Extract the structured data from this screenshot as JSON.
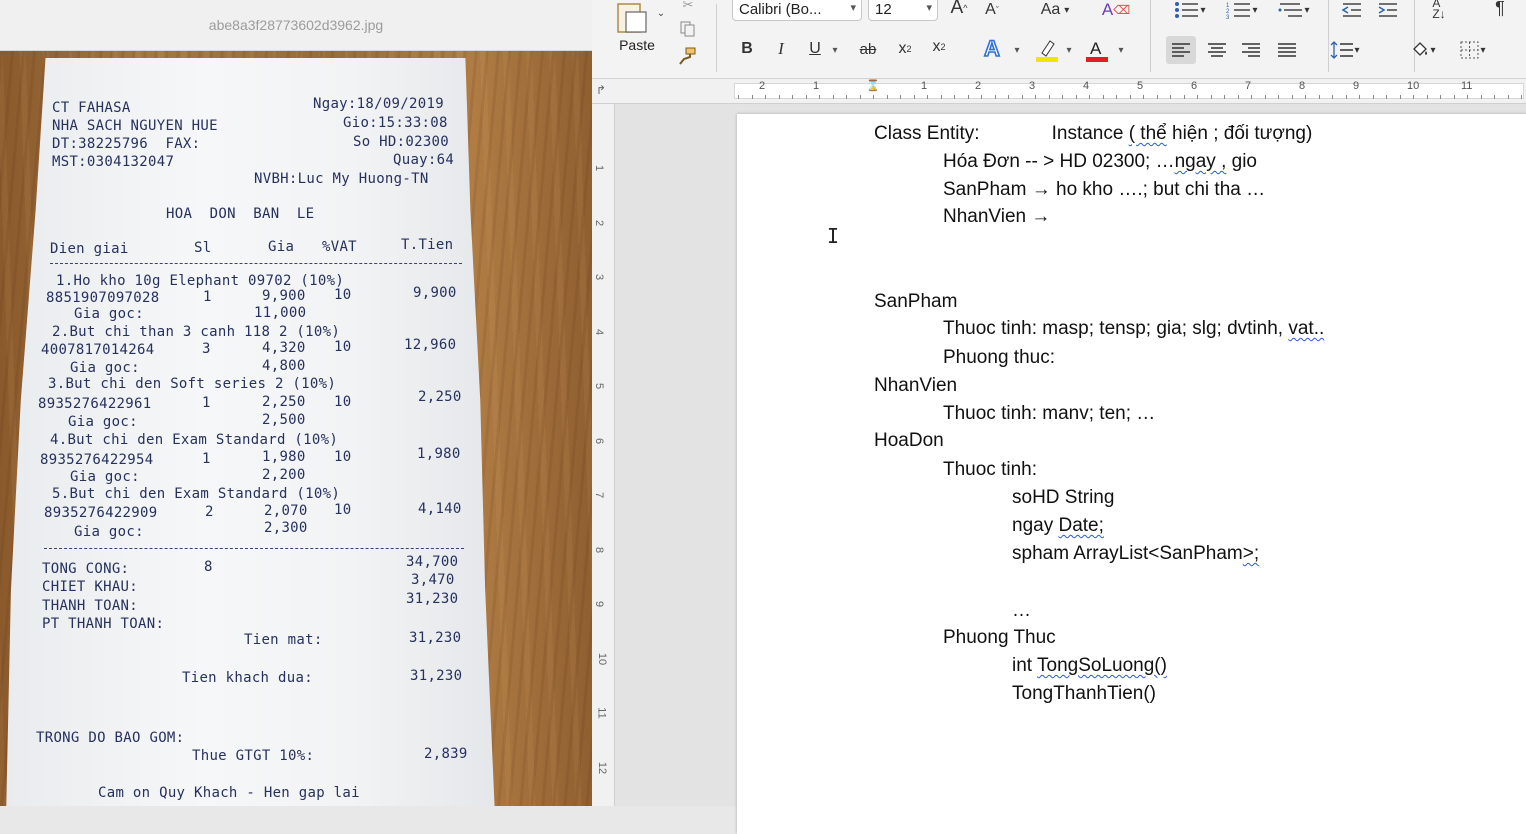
{
  "viewer": {
    "title": "abe8a3f28773602d3962.jpg",
    "receipt": {
      "store": "CT FAHASA",
      "branch": "NHA SACH NGUYEN HUE",
      "phone_fax": "DT:38225796  FAX:",
      "tax_id": "MST:0304132047",
      "date": "Ngay:18/09/2019",
      "time": "Gio:15:33:08",
      "invoice_no": "So HD:02300",
      "counter": "Quay:64",
      "staff": "NVBH:Luc My Huong-TN",
      "heading": "HOA  DON  BAN  LE",
      "col_desc": "Dien giai",
      "col_qty": "Sl",
      "col_price": "Gia",
      "col_vat": "%VAT",
      "col_total": "T.Tien",
      "items": [
        {
          "name": "1.Ho kho 10g Elephant 09702 (10%)",
          "code": "8851907097028",
          "qty": "1",
          "price": "9,900",
          "vat": "10",
          "total": "9,900",
          "orig_label": "Gia goc:",
          "orig": "11,000"
        },
        {
          "name": "2.But chi than 3 canh 118 2 (10%)",
          "code": "4007817014264",
          "qty": "3",
          "price": "4,320",
          "vat": "10",
          "total": "12,960",
          "orig_label": "Gia goc:",
          "orig": "4,800"
        },
        {
          "name": "3.But chi den Soft series 2 (10%)",
          "code": "8935276422961",
          "qty": "1",
          "price": "2,250",
          "vat": "10",
          "total": "2,250",
          "orig_label": "Gia goc:",
          "orig": "2,500"
        },
        {
          "name": "4.But chi den Exam Standard (10%)",
          "code": "8935276422954",
          "qty": "1",
          "price": "1,980",
          "vat": "10",
          "total": "1,980",
          "orig_label": "Gia goc:",
          "orig": "2,200"
        },
        {
          "name": "5.But chi den Exam Standard (10%)",
          "code": "8935276422909",
          "qty": "2",
          "price": "2,070",
          "vat": "10",
          "total": "4,140",
          "orig_label": "Gia goc:",
          "orig": "2,300"
        }
      ],
      "total_label": "TONG CONG:",
      "total_qty": "8",
      "total_value": "34,700",
      "discount_label": "CHIET KHAU:",
      "discount_value": "3,470",
      "pay_label": "THANH TOAN:",
      "pay_value": "31,230",
      "method_label": "PT THANH TOAN:",
      "cash_label": "Tien mat:",
      "cash_value": "31,230",
      "given_label": "Tien khach dua:",
      "given_value": "31,230",
      "incl_label": "TRONG DO BAO GOM:",
      "vat_label": "Thue GTGT 10%:",
      "vat_value": "2,839",
      "thanks": "Cam on Quy Khach - Hen gap lai"
    }
  },
  "ribbon": {
    "paste_label": "Paste",
    "font_name": "Calibri (Bo...",
    "font_size": "12",
    "grow_font": "A",
    "shrink_font": "A",
    "change_case": "Aa",
    "bold": "B",
    "italic": "I",
    "underline": "U",
    "strike": "ab",
    "subscript": "x",
    "superscript": "x",
    "text_effects": "A",
    "highlight_color": "#f5e400",
    "font_color": "#e02020",
    "pilcrow": "¶"
  },
  "ruler": {
    "h_numbers": [
      "2",
      "1",
      "1",
      "2",
      "3",
      "4",
      "5",
      "6",
      "7",
      "8",
      "9",
      "10",
      "11"
    ],
    "v_numbers": [
      "1",
      "2",
      "3",
      "4",
      "5",
      "6",
      "7",
      "8",
      "9",
      "10",
      "11",
      "12"
    ]
  },
  "document": {
    "lines": [
      {
        "prefix": "Class Entity:",
        "extra": "Instance ",
        "sq": "( thể",
        "rest": " hiện ; đối tượng)"
      },
      {
        "prefix": "Hóa Đơn -- > HD 02300; …",
        "sq": "ngay ,",
        "rest": " gio"
      },
      {
        "text": "SanPham → ho kho ….; but chi tha …"
      },
      {
        "text": "NhanVien →"
      },
      {
        "text": "SanPham"
      },
      {
        "prefix": "Thuoc tinh: masp; tensp; gia; slg; dvtinh, ",
        "sq": "vat..",
        "rest": ""
      },
      {
        "text": "Phuong thuc:"
      },
      {
        "text": "NhanVien"
      },
      {
        "text": "Thuoc tinh: manv; ten; …"
      },
      {
        "text": "HoaDon"
      },
      {
        "text": "Thuoc tinh:"
      },
      {
        "text": "soHD String"
      },
      {
        "prefix": "ngay ",
        "sq": "Date;",
        "rest": ""
      },
      {
        "prefix": "spham ArrayList<SanPham",
        "sq": ">;",
        "rest": ""
      },
      {
        "text": "…"
      },
      {
        "text": "Phuong Thuc"
      },
      {
        "prefix": "int ",
        "sq": "TongSoLuong()",
        "rest": ""
      },
      {
        "text": "TongThanhTien()"
      }
    ]
  }
}
